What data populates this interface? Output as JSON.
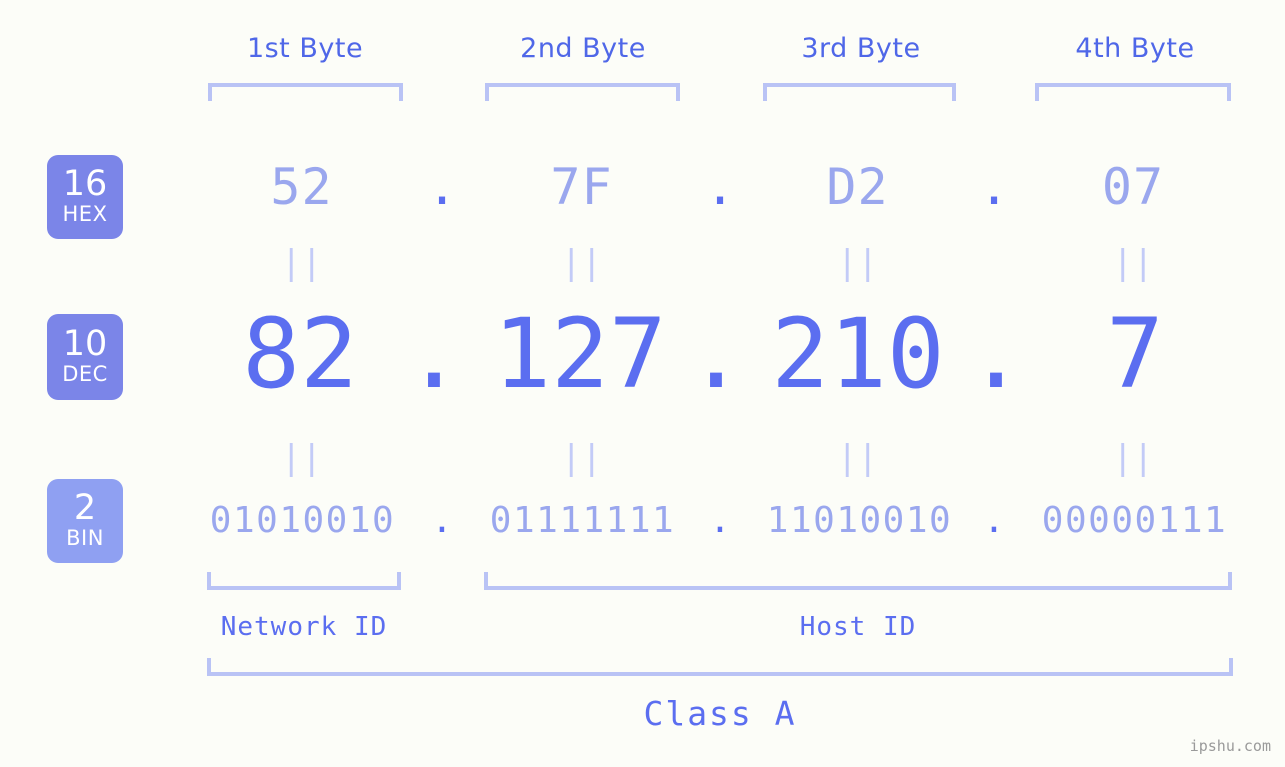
{
  "page": {
    "background_color": "#fcfdf8",
    "accent_strong": "#5b6ef0",
    "accent_light": "#9aa7ee",
    "bracket_color": "#b9c3f5",
    "badge_color": "#7b85e8",
    "badge_color_light": "#8fa0f2",
    "watermark": "ipshu.com"
  },
  "byte_headers": [
    {
      "label": "1st Byte"
    },
    {
      "label": "2nd Byte"
    },
    {
      "label": "3rd Byte"
    },
    {
      "label": "4th Byte"
    }
  ],
  "radix_badges": [
    {
      "base": "16",
      "name": "HEX"
    },
    {
      "base": "10",
      "name": "DEC"
    },
    {
      "base": "2",
      "name": "BIN"
    }
  ],
  "rows": {
    "hex": {
      "base": "16",
      "name": "HEX",
      "values": [
        "52",
        "7F",
        "D2",
        "07"
      ],
      "separator": "."
    },
    "dec": {
      "base": "10",
      "name": "DEC",
      "values": [
        "82",
        "127",
        "210",
        "7"
      ],
      "separator": "."
    },
    "bin": {
      "base": "2",
      "name": "BIN",
      "values": [
        "01010010",
        "01111111",
        "11010010",
        "00000111"
      ],
      "separator": "."
    }
  },
  "equals_marks": {
    "glyph": "||",
    "count_per_row": 4,
    "rows": 2
  },
  "segments": {
    "network_id": {
      "label": "Network ID"
    },
    "host_id": {
      "label": "Host ID"
    },
    "class": {
      "label": "Class A"
    }
  }
}
